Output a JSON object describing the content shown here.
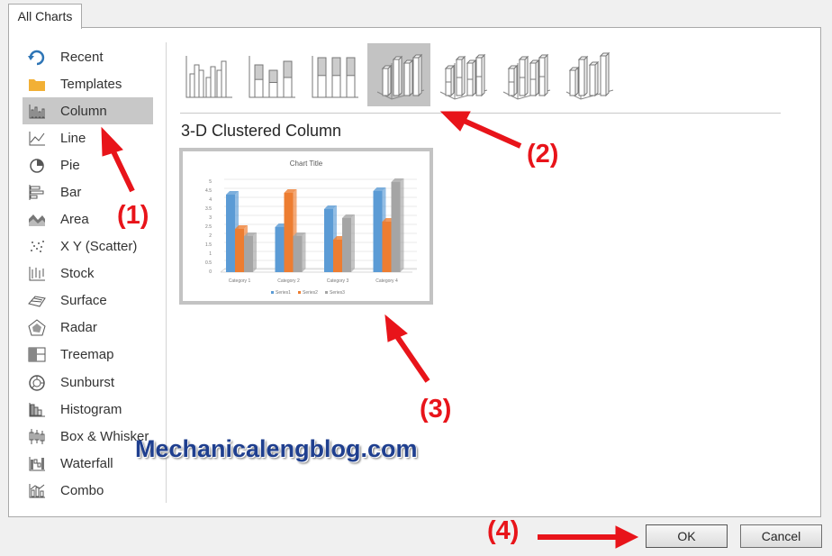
{
  "tab": {
    "label": "All Charts"
  },
  "categories": [
    {
      "label": "Recent",
      "icon": "recent-icon"
    },
    {
      "label": "Templates",
      "icon": "folder-icon"
    },
    {
      "label": "Column",
      "icon": "column-chart-icon",
      "selected": true
    },
    {
      "label": "Line",
      "icon": "line-chart-icon"
    },
    {
      "label": "Pie",
      "icon": "pie-chart-icon"
    },
    {
      "label": "Bar",
      "icon": "bar-chart-icon"
    },
    {
      "label": "Area",
      "icon": "area-chart-icon"
    },
    {
      "label": "X Y (Scatter)",
      "icon": "scatter-chart-icon"
    },
    {
      "label": "Stock",
      "icon": "stock-chart-icon"
    },
    {
      "label": "Surface",
      "icon": "surface-chart-icon"
    },
    {
      "label": "Radar",
      "icon": "radar-chart-icon"
    },
    {
      "label": "Treemap",
      "icon": "treemap-chart-icon"
    },
    {
      "label": "Sunburst",
      "icon": "sunburst-chart-icon"
    },
    {
      "label": "Histogram",
      "icon": "histogram-chart-icon"
    },
    {
      "label": "Box & Whisker",
      "icon": "box-whisker-chart-icon"
    },
    {
      "label": "Waterfall",
      "icon": "waterfall-chart-icon"
    },
    {
      "label": "Combo",
      "icon": "combo-chart-icon"
    }
  ],
  "subtypes": [
    {
      "name": "clustered-column"
    },
    {
      "name": "stacked-column"
    },
    {
      "name": "100-stacked-column"
    },
    {
      "name": "3d-clustered-column",
      "selected": true
    },
    {
      "name": "3d-stacked-column"
    },
    {
      "name": "3d-100-stacked-column"
    },
    {
      "name": "3d-column"
    }
  ],
  "selected_subtype_title": "3-D Clustered Column",
  "preview": {
    "title": "Chart Title",
    "legend": [
      "Series1",
      "Series2",
      "Series3"
    ]
  },
  "chart_data": {
    "type": "bar",
    "title": "Chart Title",
    "categories": [
      "Category 1",
      "Category 2",
      "Category 3",
      "Category 4"
    ],
    "series": [
      {
        "name": "Series1",
        "values": [
          4.3,
          2.5,
          3.5,
          4.5
        ],
        "color": "#5b9bd5"
      },
      {
        "name": "Series2",
        "values": [
          2.4,
          4.4,
          1.8,
          2.8
        ],
        "color": "#ed7d31"
      },
      {
        "name": "Series3",
        "values": [
          2,
          2,
          3,
          5
        ],
        "color": "#a5a5a5"
      }
    ],
    "ylim": [
      0,
      5
    ],
    "yticks": [
      "0",
      "0.5",
      "1",
      "1.5",
      "2",
      "2.5",
      "3",
      "3.5",
      "4",
      "4.5",
      "5"
    ],
    "grid": true,
    "legend_position": "bottom"
  },
  "buttons": {
    "ok": "OK",
    "cancel": "Cancel"
  },
  "annotations": [
    "(1)",
    "(2)",
    "(3)",
    "(4)"
  ],
  "watermark": "Mechanicalengblog.com",
  "colors": {
    "selected_bg": "#c8c8c8",
    "annotation_red": "#e8141a"
  }
}
